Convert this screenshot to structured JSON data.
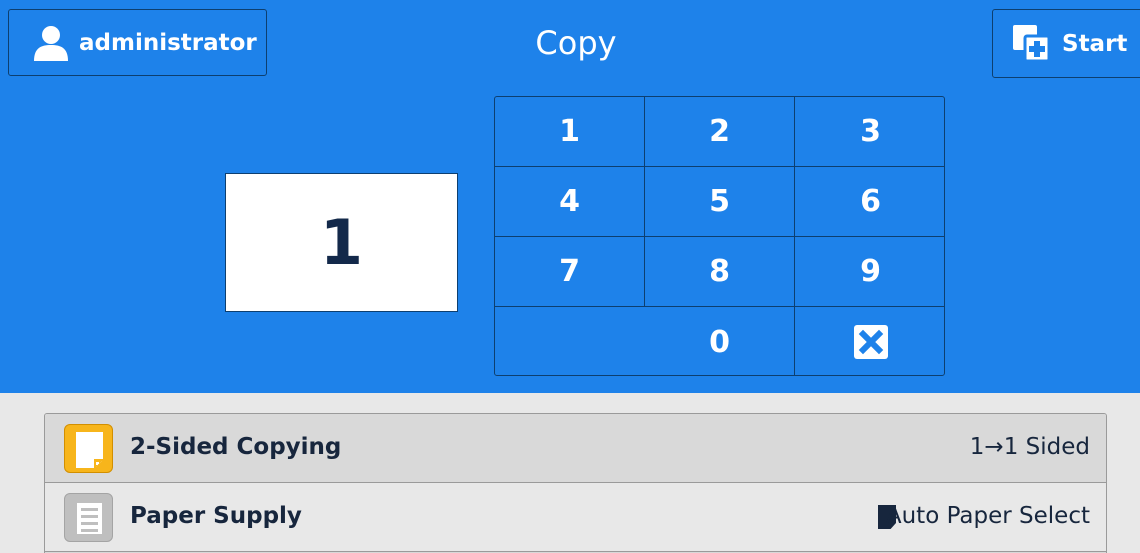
{
  "header": {
    "user_label": "administrator",
    "title": "Copy",
    "start_label": "Start"
  },
  "quantity": {
    "value": "1"
  },
  "keypad": {
    "keys": [
      "1",
      "2",
      "3",
      "4",
      "5",
      "6",
      "7",
      "8",
      "9",
      "0"
    ],
    "clear_icon": "clear-x-icon"
  },
  "features": [
    {
      "name": "2-Sided Copying",
      "value": "1→1 Sided",
      "icon": "two-sided-copy-icon"
    },
    {
      "name": "Paper Supply",
      "value": "Auto Paper Select",
      "icon": "paper-supply-icon"
    }
  ],
  "colors": {
    "primary_blue": "#1e82ea",
    "dark_border": "#0d3f70",
    "text_dark": "#17263d",
    "yellow_icon": "#f7b51b",
    "gray_icon": "#bfbfbf"
  }
}
